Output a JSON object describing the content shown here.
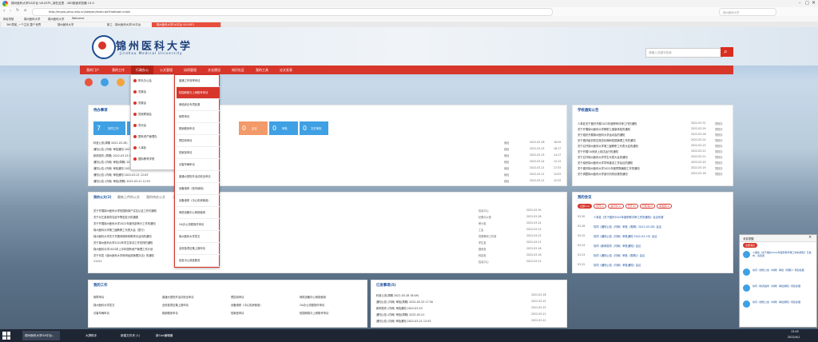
{
  "browser": {
    "window_title": "锦州医科大学OA平台 V8.0SP1_我在这里 - 360极速浏览器 13.0",
    "url": "http://mysis.jzmu.edu.cn/seeyon/main.do?method=main",
    "bookmarks": [
      "网址导航",
      "锦州医科大学",
      "锦州医科大学",
      "Welcome"
    ],
    "tabs": [
      "360导航_一个主页,整个世界",
      "锦州医科大学",
      "新工 - 锦州医科大学OA平台",
      "锦州医科大学OA平台 V8.0SP1"
    ],
    "search_placeholder": "锦州医科大学"
  },
  "header": {
    "title": "锦州医科大学",
    "subtitle": "Jinzhou Medical University",
    "search_placeholder": "请输入关键字检索"
  },
  "nav": [
    "我的门户",
    "我的工作",
    "行政办公",
    "公文管理",
    "协同管理",
    "文化建设",
    "知识社区",
    "我的工具",
    "论文发表"
  ],
  "dropdown_left": [
    {
      "label": "院长办公会"
    },
    {
      "label": "党委会"
    },
    {
      "label": "党委会"
    },
    {
      "label": "党政联席会"
    },
    {
      "label": "党代会"
    },
    {
      "label": "国有资产管理办"
    },
    {
      "label": "人事处"
    },
    {
      "label": "国际教育学院"
    }
  ],
  "dropdown_right": [
    "普通工作效率申请",
    "校园网络与上网账号申请",
    "网络综合专项处置",
    "故障申请",
    "报销程序申请",
    "预招待申请",
    "档案室申请",
    "访客车辆申请",
    "普通大型校外活动安全申请",
    "设备维修（校内使用）",
    "设备维修（中心机房使用）",
    "网络设备中心网络使用",
    "OA办公流程操作申请",
    "锦州医科大学发文",
    "全校各项征集上报申请",
    "信息中心调查服务"
  ],
  "todo": {
    "title": "待办事项",
    "boxes": [
      {
        "count": "7",
        "label": "协同工作"
      },
      {
        "count": "0",
        "label": "公文"
      },
      {
        "count": "0",
        "label": "会议"
      },
      {
        "count": "0",
        "label": "审批"
      },
      {
        "count": "0",
        "label": "文件审批"
      }
    ],
    "rows": [
      {
        "text": "科室公务(周期 2022-03-28)",
        "dept": "我处",
        "date": "2022-03-28",
        "time": "18:09"
      },
      {
        "text": "通知公告 (内网) 审批通知 2022-03-25 17:30",
        "dept": "我处",
        "date": "2022-03-25",
        "time": "18:17"
      },
      {
        "text": "新闻发布 (周期) 2022-03-25 10:17",
        "dept": "我处",
        "date": "2022-03-25",
        "time": "14:17"
      },
      {
        "text": "通知公告 (内网) 审批(周期) 2022-03-24 10:23",
        "dept": "我处",
        "date": "2022-03-24",
        "time": "12:13"
      },
      {
        "text": "通知公告 (内网) 审批通知 2022-03-21 17:33",
        "dept": "我处",
        "date": "2022-03-21",
        "time": "17:33"
      },
      {
        "text": "通知公告 (内网) 审批通知 2022-03-21 12:03",
        "dept": "我处",
        "date": "2022-03-21",
        "time": "12:03"
      },
      {
        "text": "通知公告 (内网) 审批(周期) 2022-03-21 12:53",
        "dept": "我处",
        "date": "2022-03-21",
        "time": "12:53"
      }
    ]
  },
  "news": {
    "title": "学校通知公告",
    "rows": [
      {
        "text": "人事处关于做好开展2022年度职称评审工作的通知",
        "date": "2022-03-31",
        "dept": "党校办"
      },
      {
        "text": "关于开展锦州医科大学教职工健康体检的通知",
        "date": "2022-03-29",
        "dept": "党校办"
      },
      {
        "text": "关于组织开展锦州医科大学运动会的通知",
        "date": "2022-03-28",
        "dept": "党校办"
      },
      {
        "text": "关于做好疫情防控常态化期间校园管理工作的通知",
        "date": "2022-03-24",
        "dept": "党校办"
      },
      {
        "text": "关于召开锦州医科大学第三届教职工代表大会的通知",
        "date": "2022-03-23",
        "dept": "党校办"
      },
      {
        "text": "关于开展OA系统上线试运行的通知",
        "date": "2022-03-22",
        "dept": "党校办"
      },
      {
        "text": "关于召开锦州医科大学学生代表大会的通知",
        "date": "2022-03-21",
        "dept": "党校办"
      },
      {
        "text": "关于组织锦州医科大学学科建设工作会议的通知",
        "date": "2022-03-20",
        "dept": "党校办"
      },
      {
        "text": "关于做好锦州医科大学2022年度预算编制工作的通知",
        "date": "2022-03-19",
        "dept": "党校办"
      },
      {
        "text": "关于调整锦州医科大学部分机构设置的通知",
        "date": "2022-03-18",
        "dept": "党校办"
      }
    ]
  },
  "docs": {
    "tabs": [
      "我的公文(2)",
      "最新上传的公文",
      "我的待办公文",
      "已办公文"
    ],
    "rows": [
      {
        "text": "关于开展锦州医科大学校园网用户实名认证工作的通知",
        "unit": "信息中心",
        "date": "2022-03-30"
      },
      {
        "text": "关于对王某某同志给予警告处分的通报",
        "unit": "纪委办公室",
        "date": "2022-03-28"
      },
      {
        "text": "关于开展锦州医科大学2022年度内部审计工作的通知",
        "unit": "审计处",
        "date": "2022-03-24"
      },
      {
        "text": "锦州医科大学第三届教职工代表大会（暂行）",
        "unit": "工会",
        "date": "2022-03-23"
      },
      {
        "text": "锦州医科大学关于开展师德师风教育月活动的通知",
        "unit": "党委教师工作部",
        "date": "2022-03-22"
      },
      {
        "text": "关于锦州医科大学2022年学生军训工作安排的通知",
        "unit": "学生处",
        "date": "2022-03-21"
      },
      {
        "text": "锦州医科大学2022年上半年国有资产管理工作计划",
        "unit": "国资处",
        "date": "2022-03-18"
      },
      {
        "text": "关于印发《锦州医科大学科研经费管理办法》的通知",
        "unit": "科技处",
        "date": "2022-03-16"
      },
      {
        "text": "11111",
        "unit": "信息中心",
        "date": "2022-03-15"
      }
    ]
  },
  "meetings": {
    "title": "我的会议",
    "pills": [
      "全部(11)",
      "待开(1)",
      "进行中(0)",
      "已开(8)",
      "已取消(0)",
      "我发起(2)"
    ],
    "rows": [
      {
        "date": "03-30",
        "text": "人事处《关于做好2022年度职称评审工作的通知》会议布置"
      },
      {
        "date": "03-28",
        "text": "协同《通知公告（内网）审批（周期）2022-03-28》会议"
      },
      {
        "date": "03-25",
        "text": "协同《通知公告（内网）审批通知 2022-03-25》会议"
      },
      {
        "date": "03-24",
        "text": "协同《新闻发布（内网）审批通知》会议"
      },
      {
        "date": "03-23",
        "text": "协同《通知公告（内网）审批（周期）》会议"
      },
      {
        "date": "03-22",
        "text": "协同《通知公告（内网）审批通知》会议"
      }
    ]
  },
  "mywork": {
    "title": "我的工作",
    "items": [
      "故障申请",
      "普通大型校外活动安全申请",
      "预招待申请",
      "网络设备中心网络使用",
      "锦州医科大学发文",
      "全校各项征集上报申请",
      "设备维修（中心机房使用）",
      "OA办公流程操作申请",
      "访客车辆申请",
      "报销程序申请",
      "档案室申请",
      "校园网络与上网账号申请"
    ]
  },
  "sent": {
    "title": "已发事项(5)",
    "rows": [
      {
        "text": "科室公务(周期 2022-03-28 18:09)",
        "date": "2022-03-28"
      },
      {
        "text": "通知公告 (内网) 审批(周期) 2022-03-25 17:30",
        "date": "2022-03-25"
      },
      {
        "text": "新闻发布 (内网) 审批通知 2022-03-25",
        "date": "2022-03-25"
      },
      {
        "text": "通知公告 (内网) 审批(周期) 2022-03-21",
        "date": "2022-03-21"
      },
      {
        "text": "通知公告 (内网) 审批通知 2022-03-21 12:53",
        "date": "2022-03-21"
      }
    ]
  },
  "popup": {
    "title": "消息提醒",
    "tab": "全部消息",
    "items": [
      "人事处《关于做好2022年度职称评审工作的通知》已发布，请查阅",
      "协同《通知公告（内网）审批（周期）》待您处理",
      "协同《新闻发布（内网）审批通知》待您处理",
      "协同《通知公告（内网）审批通知》待您处理"
    ]
  },
  "taskbar": {
    "items": [
      "锦州医科大学OA平台...",
      "大屏助手",
      "新建文件夹 (1)",
      "新Cad编辑器"
    ],
    "time": "13:45",
    "date": "2022/4/1"
  }
}
